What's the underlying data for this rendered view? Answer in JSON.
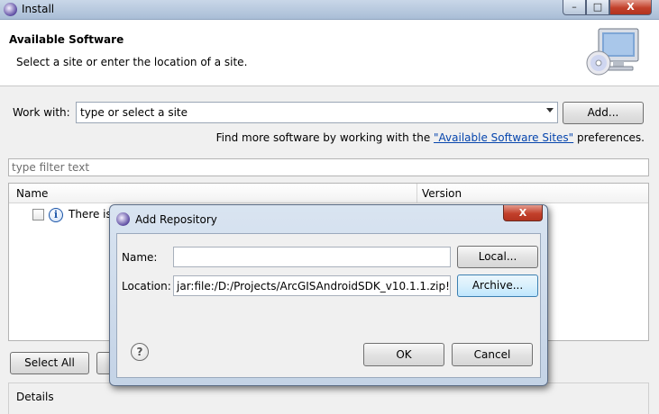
{
  "window": {
    "title": "Install",
    "controls": {
      "minimize": "–",
      "maximize": "□",
      "close": "X"
    }
  },
  "header": {
    "title": "Available Software",
    "description": "Select a site or enter the location of a site.",
    "art_icon": "monitor-cd-icon"
  },
  "work_with": {
    "label": "Work with:",
    "value": "type or select a site",
    "add_button": "Add..."
  },
  "find_more": {
    "prefix": "Find more software by working with the ",
    "link": "\"Available Software Sites\"",
    "suffix": " preferences."
  },
  "filter": {
    "placeholder": "type filter text"
  },
  "table": {
    "columns": [
      "Name",
      "Version"
    ],
    "rows": [
      {
        "text": "There is",
        "icon": "info-icon",
        "checked": false
      }
    ]
  },
  "buttons": {
    "select_all": "Select All"
  },
  "details": {
    "label": "Details"
  },
  "dialog": {
    "title": "Add Repository",
    "close": "X",
    "name_label": "Name:",
    "name_value": "",
    "location_label": "Location:",
    "location_value": "jar:file:/D:/Projects/ArcGISAndroidSDK_v10.1.1.zip!/",
    "local_button": "Local...",
    "archive_button": "Archive...",
    "help": "?",
    "ok_button": "OK",
    "cancel_button": "Cancel"
  }
}
